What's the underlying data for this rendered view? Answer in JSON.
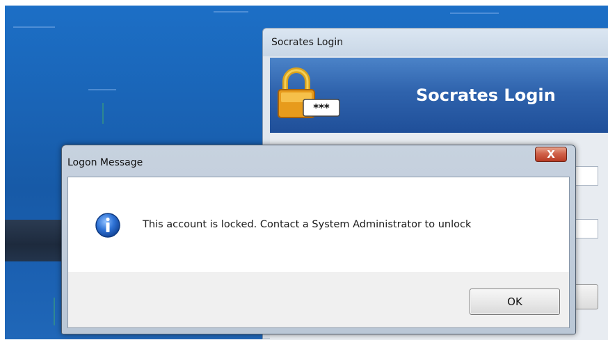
{
  "background_window": {
    "title": "Socrates Login",
    "banner_title": "Socrates Login",
    "lock_badge_text": "***"
  },
  "dialog": {
    "title": "Logon Message",
    "close_label": "X",
    "message": "This account is locked. Contact a System Administrator to unlock",
    "ok_label": "OK"
  },
  "icons": {
    "dialog_icon": "info-icon",
    "banner_icon": "padlock-icon",
    "close_icon": "close-icon"
  },
  "colors": {
    "desktop_blue": "#1a64b6",
    "banner_blue": "#2f63ad",
    "close_red": "#c54a32",
    "info_blue": "#1f5fbf"
  }
}
